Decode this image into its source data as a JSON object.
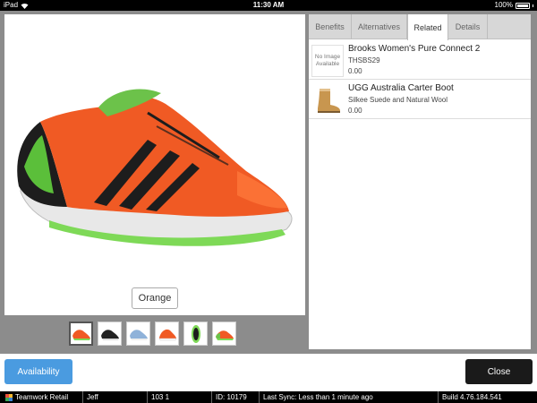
{
  "status_bar": {
    "carrier": "iPad",
    "time": "11:30 AM",
    "battery": "100%"
  },
  "product": {
    "color_button_label": "Orange",
    "thumbnails": [
      {
        "icon": "shoe-orange-thumbnail",
        "selected": true
      },
      {
        "icon": "shoe-black-thumbnail",
        "selected": false
      },
      {
        "icon": "shoe-blue-thumbnail",
        "selected": false
      },
      {
        "icon": "shoe-orange-side-thumbnail",
        "selected": false
      },
      {
        "icon": "shoe-sole-thumbnail",
        "selected": false
      },
      {
        "icon": "shoe-top-thumbnail",
        "selected": false
      }
    ]
  },
  "tabs": [
    {
      "label": "Benefits",
      "active": false
    },
    {
      "label": "Alternatives",
      "active": false
    },
    {
      "label": "Related",
      "active": true
    },
    {
      "label": "Details",
      "active": false
    }
  ],
  "related": [
    {
      "image_text": "No Image Available",
      "name": "Brooks Women's Pure Connect 2",
      "sub": "THSBS29",
      "price": "0.00"
    },
    {
      "image_icon": "boot-icon",
      "name": "UGG Australia Carter Boot",
      "sub": "Silkee Suede and Natural Wool",
      "price": "0.00"
    }
  ],
  "actions": {
    "availability_label": "Availability",
    "close_label": "Close"
  },
  "footer": {
    "brand": "Teamwork Retail",
    "user": "Jeff",
    "store": "103 1",
    "id": "ID: 10179",
    "sync": "Last Sync: Less than 1 minute ago",
    "build": "Build 4.76.184.541"
  },
  "colors": {
    "accent_blue": "#4a9be0",
    "dark_button": "#1a1a1a",
    "shoe_orange": "#f05a24",
    "shoe_green": "#6cc24a"
  }
}
